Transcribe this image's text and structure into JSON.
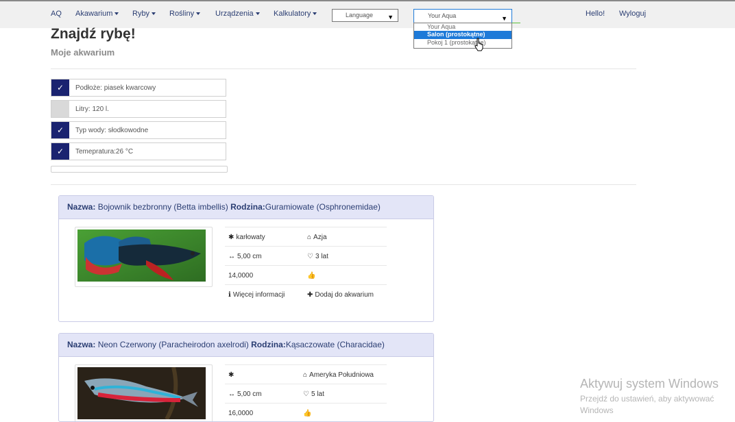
{
  "nav": {
    "brand": "AQ",
    "items": [
      {
        "label": "Akawarium"
      },
      {
        "label": "Ryby"
      },
      {
        "label": "Rośliny"
      },
      {
        "label": "Urządzenia"
      },
      {
        "label": "Kalkulatory"
      }
    ],
    "language_select": "Language",
    "aqua_select": "Your Aqua",
    "aqua_options": [
      "Your Aqua",
      "Salon (prostokątne)",
      "Pokoj 1 (prostokątne)"
    ],
    "aqua_selected_index": 1,
    "hello": "Hello!",
    "logout": "Wyloguj"
  },
  "page": {
    "title": "Znajdź rybę!",
    "subtitle": "Moje akwarium"
  },
  "conditions": [
    {
      "text": "Podłoże: piasek kwarcowy",
      "checked": true
    },
    {
      "text": "Litry: 120 l.",
      "checked": false
    },
    {
      "text": "Typ wody: słodkowodne",
      "checked": true
    },
    {
      "text": "Temepratura:26 °C",
      "checked": true
    }
  ],
  "labels": {
    "name": "Nazwa:",
    "family": "Rodzina:",
    "more_info": "Więcej informacji",
    "add_to_aquarium": "Dodaj do akwarium"
  },
  "fish": [
    {
      "name": "Bojownik bezbronny (Betta imbellis)",
      "family": "Guramiowate (Osphronemidae)",
      "type": "karłowaty",
      "region": "Azja",
      "size": "5,00 cm",
      "lifespan": "3 lat",
      "score": "14,0000"
    },
    {
      "name": "Neon Czerwony (Paracheirodon axelrodi)",
      "family": "Kąsaczowate (Characidae)",
      "type": "",
      "region": "Ameryka Południowa",
      "size": "5,00 cm",
      "lifespan": "5 lat",
      "score": "16,0000"
    }
  ],
  "watermark": {
    "line1": "Aktywuj system Windows",
    "line2": "Przejdź do ustawień, aby aktywować",
    "line3": "Windows"
  },
  "colors": {
    "accent": "#1a2370",
    "card_header": "#e3e5f7",
    "link": "#2a3d72",
    "selection": "#1e7ad8"
  }
}
